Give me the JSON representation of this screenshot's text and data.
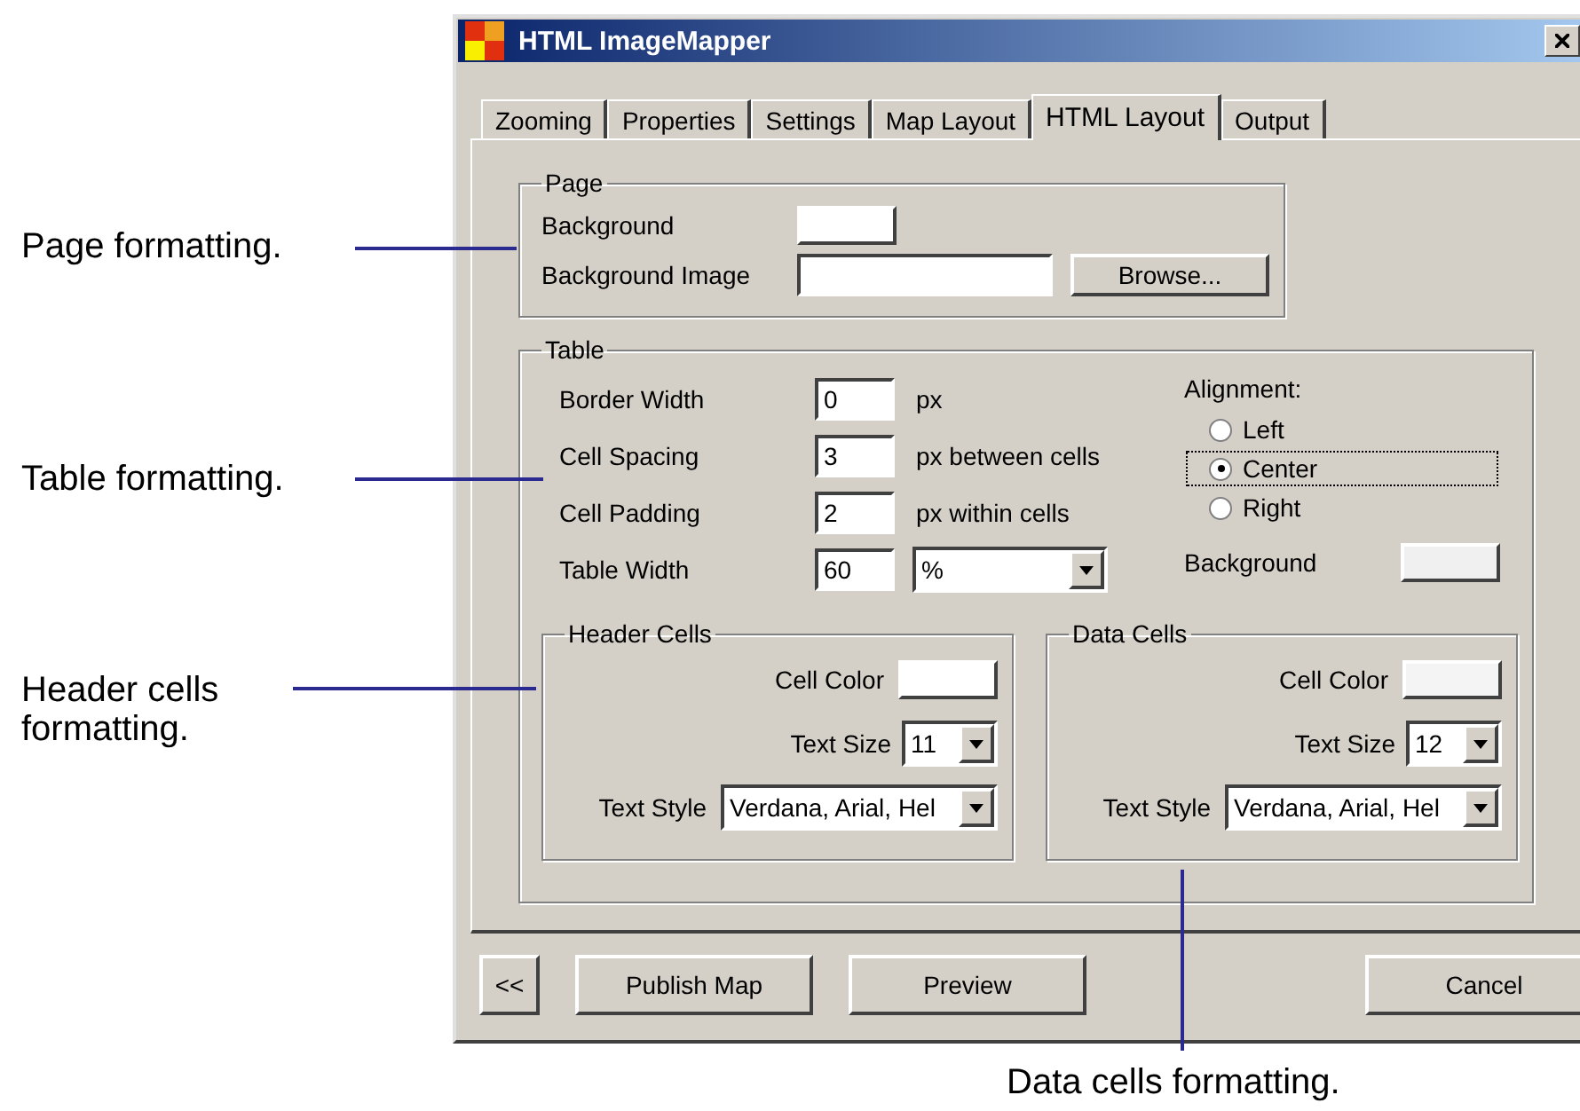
{
  "window": {
    "title": "HTML ImageMapper"
  },
  "tabs": [
    {
      "label": "Zooming",
      "selected": false
    },
    {
      "label": "Properties",
      "selected": false
    },
    {
      "label": "Settings",
      "selected": false
    },
    {
      "label": "Map Layout",
      "selected": false
    },
    {
      "label": "HTML Layout",
      "selected": true
    },
    {
      "label": "Output",
      "selected": false
    }
  ],
  "page_group": {
    "title": "Page",
    "background_label": "Background",
    "background_image_label": "Background Image",
    "browse_button": "Browse..."
  },
  "table_group": {
    "title": "Table",
    "fields": [
      {
        "label": "Border Width",
        "value": "0",
        "unit": "px"
      },
      {
        "label": "Cell Spacing",
        "value": "3",
        "unit": "px between cells"
      },
      {
        "label": "Cell Padding",
        "value": "2",
        "unit": "px within cells"
      }
    ],
    "table_width": {
      "label": "Table Width",
      "value": "60",
      "unit": "%"
    },
    "alignment": {
      "label": "Alignment:",
      "options": [
        {
          "label": "Left",
          "selected": false
        },
        {
          "label": "Center",
          "selected": true
        },
        {
          "label": "Right",
          "selected": false
        }
      ]
    },
    "background_label": "Background"
  },
  "cell_groups": [
    {
      "title": "Header Cells",
      "cell_color_label": "Cell Color",
      "text_size_label": "Text Size",
      "text_size": "11",
      "text_style_label": "Text Style",
      "text_style": "Verdana, Arial, Hel"
    },
    {
      "title": "Data Cells",
      "cell_color_label": "Cell Color",
      "text_size_label": "Text Size",
      "text_size": "12",
      "text_style_label": "Text Style",
      "text_style": "Verdana, Arial, Hel"
    }
  ],
  "buttons": [
    "<<",
    "Publish Map",
    "Preview",
    "Cancel"
  ],
  "annotations": [
    {
      "text": "Page formatting."
    },
    {
      "text": "Table formatting."
    },
    {
      "text": "Header cells formatting."
    },
    {
      "text": "Data cells formatting."
    }
  ]
}
